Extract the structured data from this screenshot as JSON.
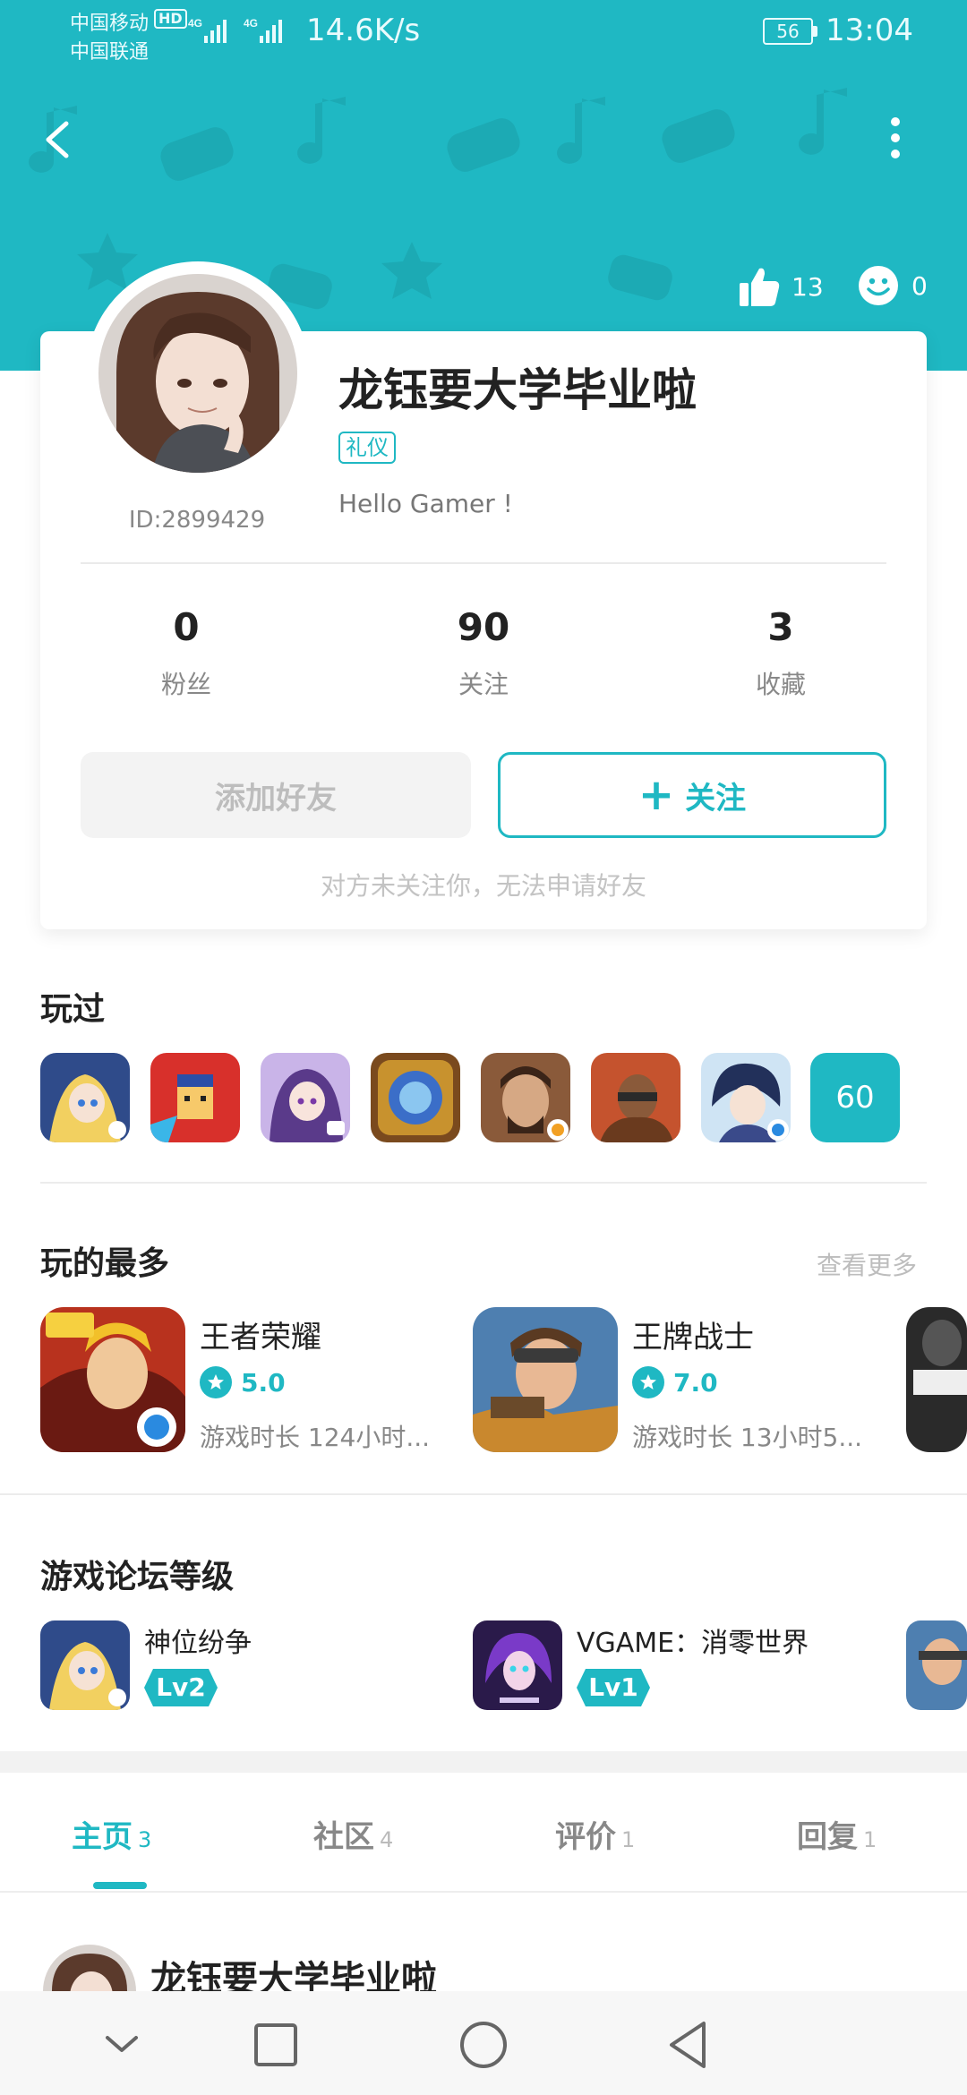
{
  "status_bar": {
    "carrier_1": "中国移动",
    "carrier_2": "中国联通",
    "hd": "HD",
    "network_speed": "14.6K/s",
    "battery": "56",
    "time": "13:04"
  },
  "header": {
    "back_icon": "chevron-left-icon",
    "more_icon": "more-vertical-icon",
    "likes_count": "13",
    "smiles_count": "0"
  },
  "profile": {
    "username": "龙钰要大学毕业啦",
    "tag": "礼仪",
    "bio": "Hello Gamer !",
    "user_id": "ID:2899429",
    "stats": [
      {
        "value": "0",
        "label": "粉丝"
      },
      {
        "value": "90",
        "label": "关注"
      },
      {
        "value": "3",
        "label": "收藏"
      }
    ],
    "add_friend_label": "添加好友",
    "follow_label": "关注",
    "hint": "对方未关注你，无法申请好友"
  },
  "played": {
    "title": "玩过",
    "total": "60"
  },
  "most_played": {
    "title": "玩的最多",
    "see_more": "查看更多",
    "games": [
      {
        "name": "王者荣耀",
        "rating": "5.0",
        "playtime": "游戏时长 124小时..."
      },
      {
        "name": "王牌战士",
        "rating": "7.0",
        "playtime": "游戏时长 13小时5..."
      }
    ]
  },
  "forum_levels": {
    "title": "游戏论坛等级",
    "games": [
      {
        "name": "神位纷争",
        "level": "Lv2"
      },
      {
        "name": "VGAME：消零世界",
        "level": "Lv1"
      }
    ]
  },
  "tabs": [
    {
      "label": "主页",
      "count": "3"
    },
    {
      "label": "社区",
      "count": "4"
    },
    {
      "label": "评价",
      "count": "1"
    },
    {
      "label": "回复",
      "count": "1"
    }
  ],
  "post": {
    "author": "龙钰要大学毕业啦"
  },
  "colors": {
    "accent": "#1fb8c3",
    "header_bg": "#1fb8c3"
  }
}
